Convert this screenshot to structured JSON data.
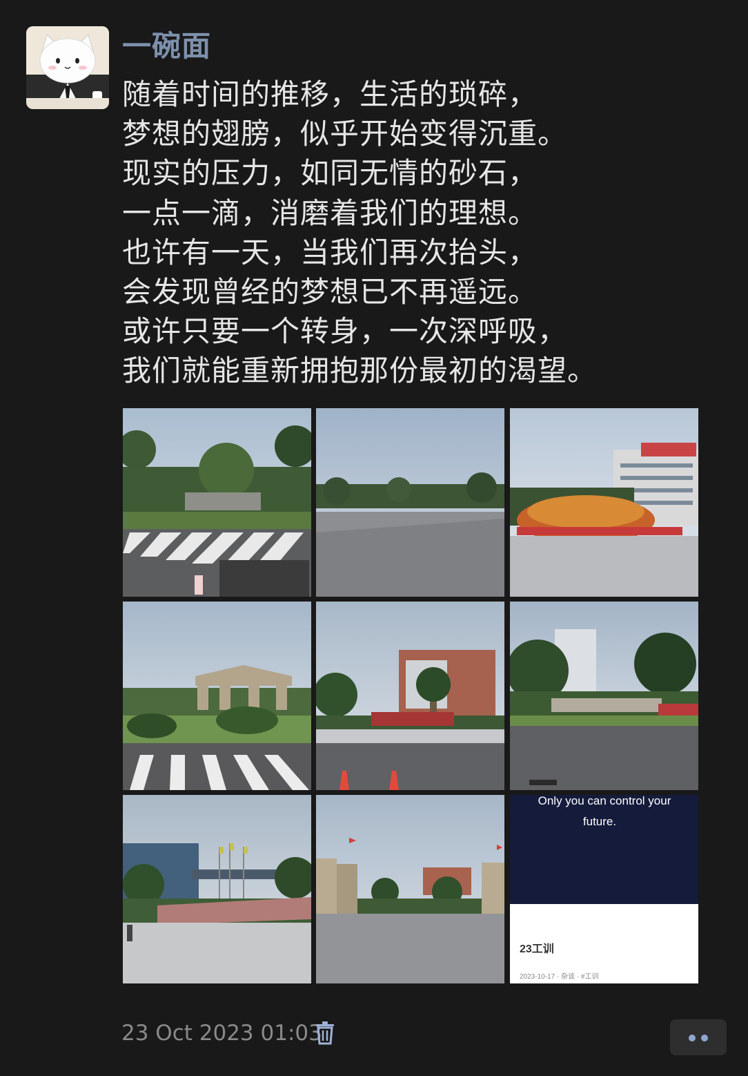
{
  "post": {
    "author": "一碗面",
    "lines": [
      "随着时间的推移，生活的琐碎，",
      "梦想的翅膀，似乎开始变得沉重。",
      "现实的压力，如同无情的砂石，",
      "一点一滴，消磨着我们的理想。",
      "也许有一天，当我们再次抬头，",
      "会发现曾经的梦想已不再遥远。",
      "或许只要一个转身，一次深呼吸，",
      "我们就能重新拥抱那份最初的渴望。"
    ],
    "timestamp": "23 Oct 2023 01:03"
  },
  "photos": {
    "card_quote_1": "Only you can control your",
    "card_quote_2": "future.",
    "card_title": "23工训",
    "card_meta": "2023-10-17 · 杂谈 · #工训"
  },
  "icons": {
    "delete": "trash-icon",
    "more": "more-dots-icon"
  },
  "colors": {
    "background": "#191919",
    "author": "#7d90ad",
    "text": "#e6e6e6",
    "timestamp": "#8a8a8a"
  }
}
